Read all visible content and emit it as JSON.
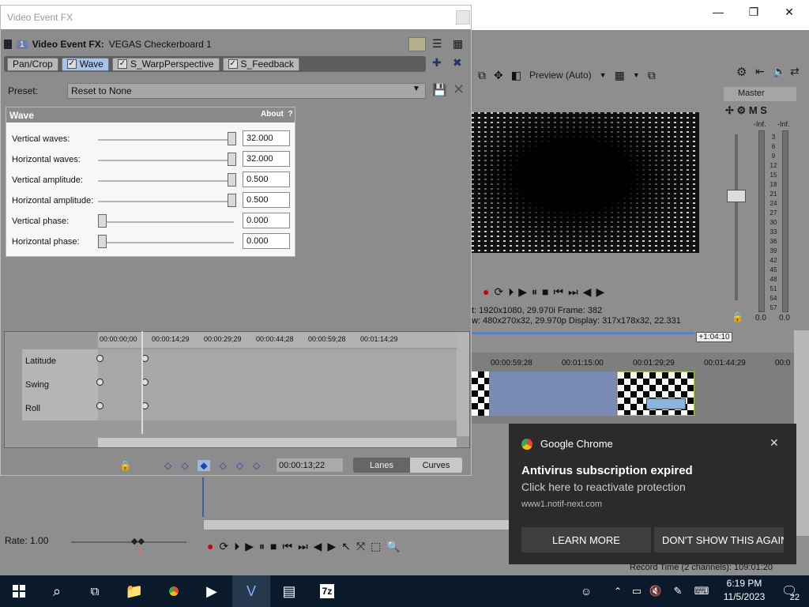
{
  "window_controls": {
    "minimize": "—",
    "maximize": "❐",
    "close": "✕"
  },
  "fx_window": {
    "title": "Video Event FX",
    "badge": "1",
    "header_label": "Video Event FX:",
    "header_value": "VEGAS Checkerboard 1",
    "chain": [
      {
        "label": "Pan/Crop",
        "checked": false,
        "active": false
      },
      {
        "label": "Wave",
        "checked": true,
        "active": true
      },
      {
        "label": "S_WarpPerspective",
        "checked": true,
        "active": false
      },
      {
        "label": "S_Feedback",
        "checked": true,
        "active": false
      }
    ],
    "preset_label": "Preset:",
    "preset_value": "Reset to None",
    "panel": {
      "title": "Wave",
      "about": "About",
      "help": "?",
      "params": [
        {
          "label": "Vertical waves:",
          "value": "32.000",
          "level": 1.0
        },
        {
          "label": "Horizontal waves:",
          "value": "32.000",
          "level": 1.0
        },
        {
          "label": "Vertical amplitude:",
          "value": "0.500",
          "level": 1.0
        },
        {
          "label": "Horizontal amplitude:",
          "value": "0.500",
          "level": 1.0
        },
        {
          "label": "Vertical phase:",
          "value": "0.000",
          "level": 0.0
        },
        {
          "label": "Horizontal phase:",
          "value": "0.000",
          "level": 0.0
        }
      ]
    },
    "keyframes": {
      "ruler": [
        "00:00:00;00",
        "00:00:14;29",
        "00:00:29;29",
        "00:00:44;28",
        "00:00:59;28",
        "00:01:14;29"
      ],
      "tracks": [
        "Latitude",
        "Swing",
        "Roll"
      ],
      "time": "00:00:13;22",
      "lanes_label": "Lanes",
      "curves_label": "Curves"
    }
  },
  "preview": {
    "quality": "Preview (Auto)",
    "info_line1": "t:  1920x1080, 29.970i     Frame:    382",
    "info_line2": "w: 480x270x32, 29.970p  Display:  317x178x32, 22.331"
  },
  "master": {
    "title": "Master",
    "inf_left": "-Inf.",
    "inf_right": "-Inf.",
    "bottom_left": "0.0",
    "bottom_right": "0.0",
    "scale": [
      "3",
      "6",
      "9",
      "12",
      "15",
      "18",
      "21",
      "24",
      "27",
      "30",
      "33",
      "36",
      "39",
      "42",
      "45",
      "48",
      "51",
      "54",
      "57"
    ]
  },
  "timeline": {
    "ruler": [
      "00:00:59;28",
      "00:01:15:00",
      "00:01:29;29",
      "00:01:44;29",
      "00:0"
    ],
    "duration_badge": "+1:04:10",
    "rate": "Rate: 1.00",
    "record_time": "Record Time (2 channels): 109:01:20"
  },
  "notification": {
    "app": "Google Chrome",
    "title": "Antivirus subscription expired",
    "message": "Click here to reactivate protection",
    "url": "www1.notif-next.com",
    "learn_more": "LEARN MORE",
    "dont_show": "DON'T SHOW THIS AGAIN"
  },
  "taskbar": {
    "time": "6:19 PM",
    "date": "11/5/2023",
    "notifications": "22"
  }
}
